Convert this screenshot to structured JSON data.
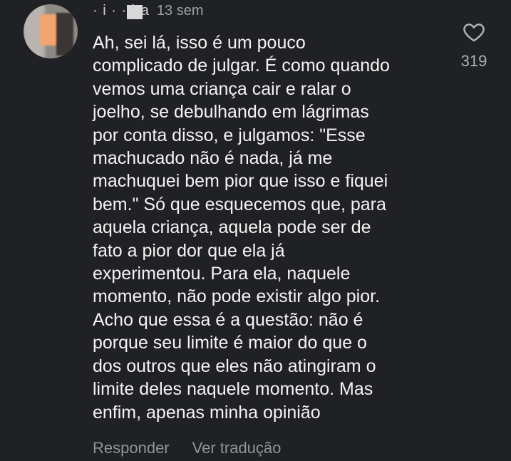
{
  "comment": {
    "username": "· i · · ira",
    "timestamp": "13 sem",
    "text": "Ah, sei lá, isso é um pouco\ncomplicado de julgar. É como quando\nvemos uma criança cair e ralar o\njoelho, se debulhando em lágrimas\npor conta disso, e julgamos: \"Esse\nmachucado não é nada, já me\nmachuquei bem pior que isso e fiquei\nbem.\" Só que esquecemos que, para\naquela criança, aquela pode ser de\nfato a pior dor que ela já\nexperimentou. Para ela, naquele\nmomento, não pode existir algo pior.\nAcho que essa é a questão: não é\nporque seu limite é maior do que o\ndos outros que eles não atingiram o\nlimite deles naquele momento. Mas\nenfim, apenas minha opinião",
    "like_icon": "heart-outline-icon",
    "like_count": "319",
    "reply_label": "Responder",
    "translate_label": "Ver tradução"
  },
  "colors": {
    "background": "#202124",
    "text": "#f4f4f4",
    "muted": "#9aa0a6"
  }
}
